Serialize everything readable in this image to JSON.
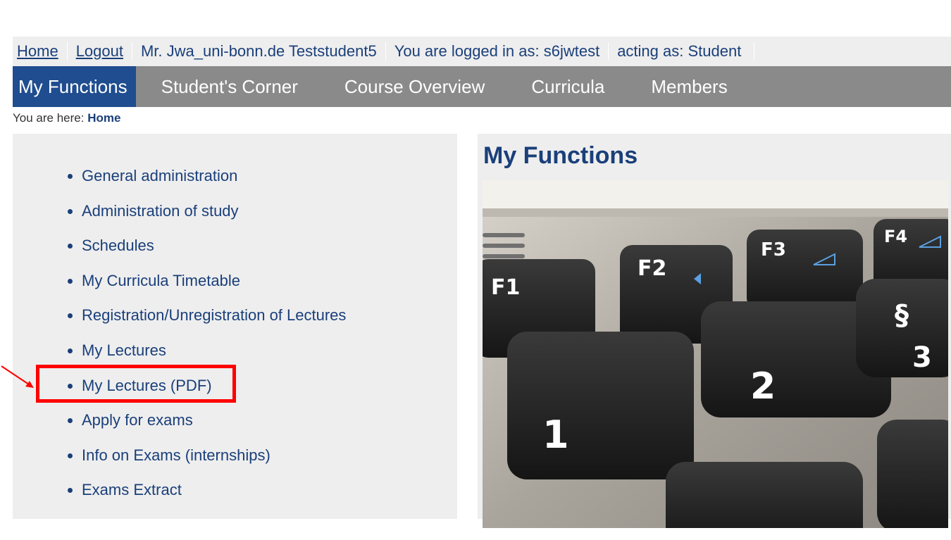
{
  "topbar": {
    "home": "Home",
    "logout": "Logout",
    "user": "Mr. Jwa_uni-bonn.de Teststudent5",
    "logged_in": "You are logged in as: s6jwtest",
    "acting": "acting as: Student"
  },
  "nav": {
    "tabs": [
      {
        "label": "My Functions",
        "active": true
      },
      {
        "label": "Student's Corner"
      },
      {
        "label": "Course Overview"
      },
      {
        "label": "Curricula"
      },
      {
        "label": "Members"
      }
    ]
  },
  "breadcrumb": {
    "prefix": "You are here:",
    "current": "Home"
  },
  "left": {
    "items": [
      {
        "label": "General administration"
      },
      {
        "label": "Administration of study"
      },
      {
        "label": "Schedules"
      },
      {
        "label": "My Curricula Timetable"
      },
      {
        "label": "Registration/Unregistration of Lectures"
      },
      {
        "label": "My Lectures"
      },
      {
        "label": "My Lectures (PDF)",
        "highlighted": true
      },
      {
        "label": "Apply for exams"
      },
      {
        "label": "Info on Exams (internships)"
      },
      {
        "label": "Exams Extract"
      }
    ]
  },
  "right": {
    "title": "My Functions",
    "photo_keys": [
      "F1",
      "F2",
      "F3",
      "F4",
      "1",
      "2",
      "§",
      "3"
    ]
  },
  "colors": {
    "link": "#1a3f7a",
    "nav_bg": "#8a8a8a",
    "nav_active": "#1f4d8f",
    "highlight": "#ff0000"
  }
}
